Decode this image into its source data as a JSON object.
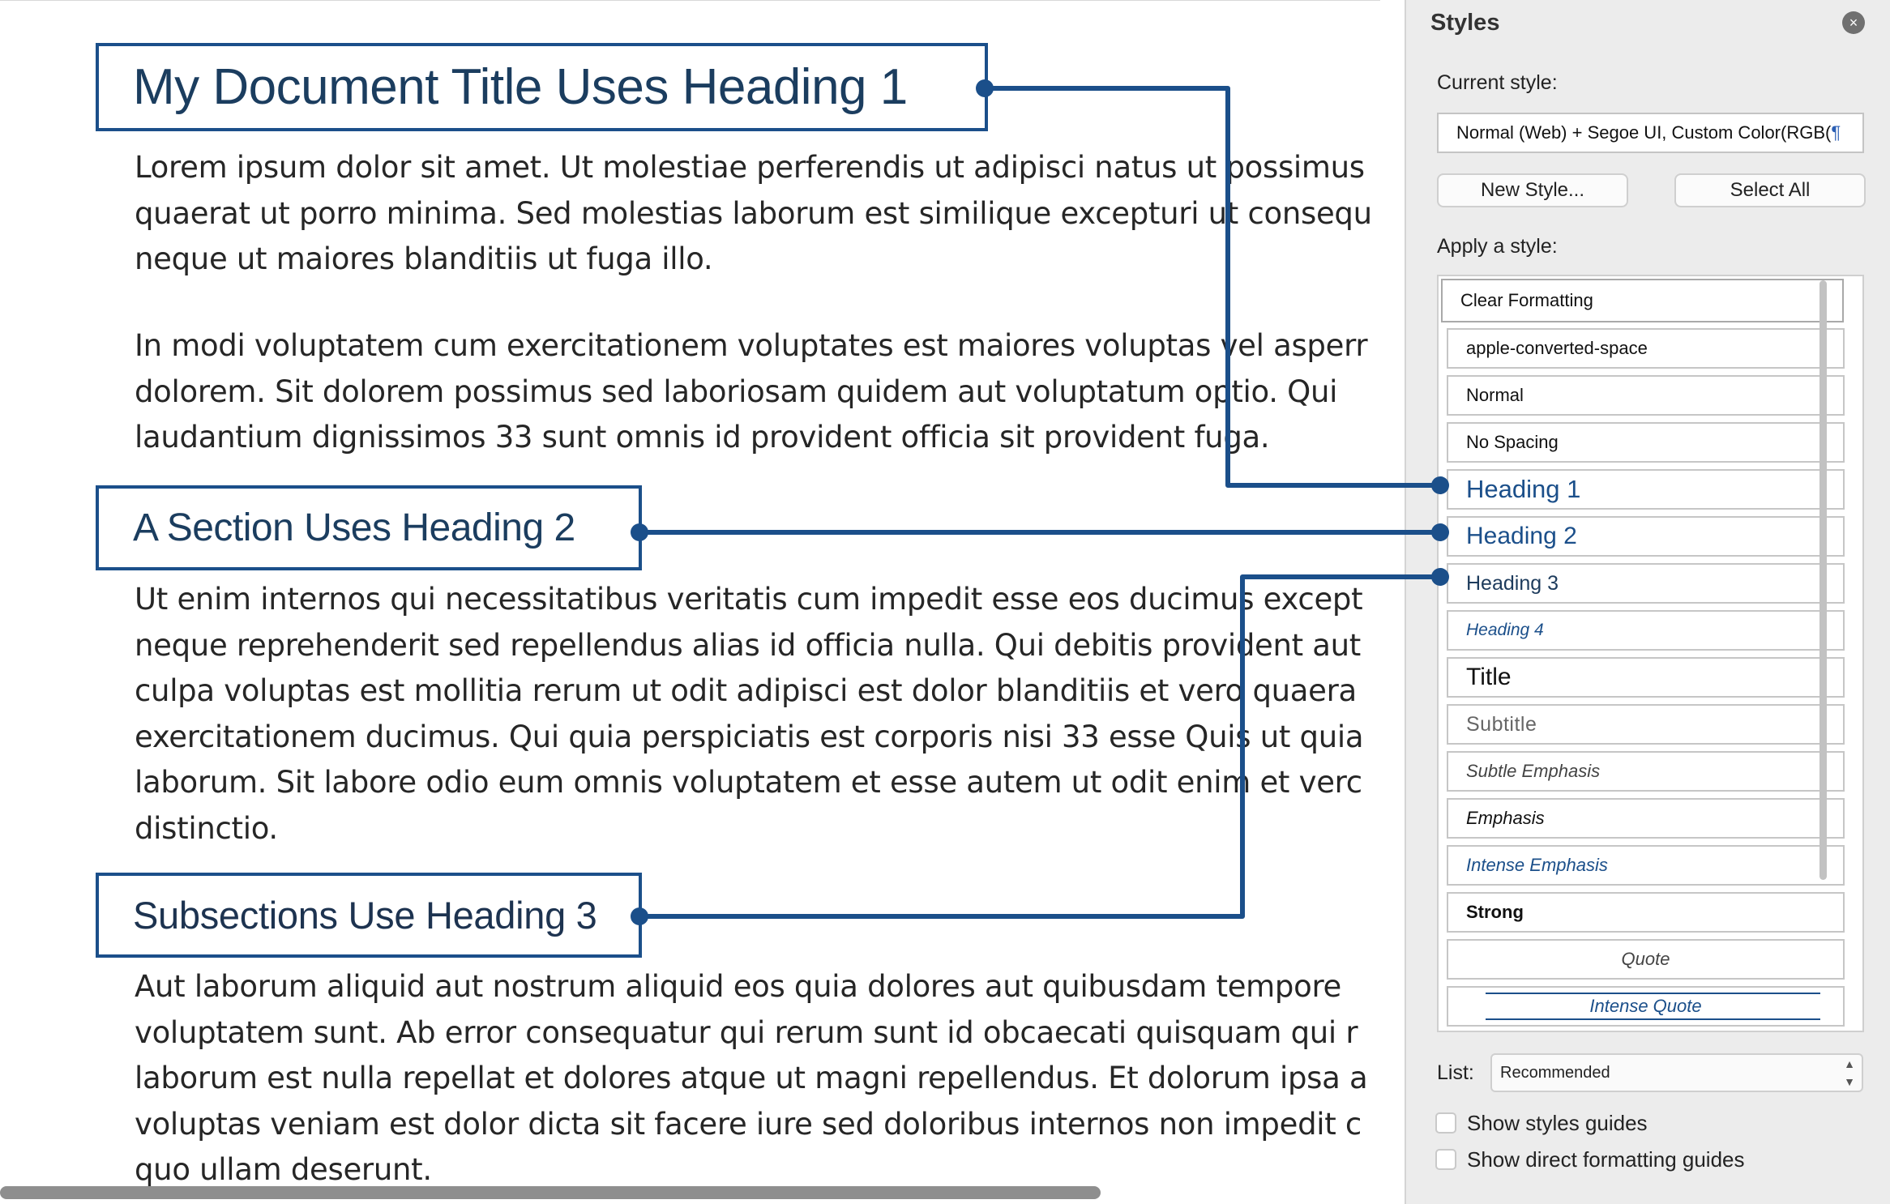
{
  "document": {
    "heading1": "My Document Title Uses Heading 1",
    "para1": [
      "Lorem ipsum dolor sit amet. Ut molestiae perferendis ut adipisci natus ut possimus",
      "quaerat ut porro minima. Sed molestias laborum est similique excepturi ut consequ",
      "neque ut maiores blanditiis ut fuga illo."
    ],
    "para2": [
      "In modi voluptatem cum exercitationem voluptates est maiores voluptas vel asperr",
      "dolorem. Sit dolorem possimus sed laboriosam quidem aut voluptatum optio. Qui",
      "laudantium dignissimos 33 sunt omnis id provident officia sit provident fuga."
    ],
    "heading2": "A Section Uses Heading 2",
    "para3": [
      "Ut enim internos qui necessitatibus veritatis cum impedit esse eos ducimus except",
      "neque reprehenderit sed repellendus alias id officia nulla. Qui debitis provident aut",
      "culpa voluptas est mollitia rerum ut odit adipisci est dolor blanditiis et vero quaera",
      "exercitationem ducimus. Qui quia perspiciatis est corporis nisi 33 esse Quis ut quia",
      "laborum. Sit labore odio eum omnis voluptatem et esse autem ut odit enim et verc",
      "distinctio."
    ],
    "heading3": "Subsections Use Heading 3",
    "para4": [
      "Aut laborum aliquid aut nostrum aliquid eos quia dolores aut quibusdam tempore",
      "voluptatem sunt. Ab error consequatur qui rerum sunt id obcaecati quisquam qui r",
      "laborum est nulla repellat et dolores atque ut magni repellendus. Et dolorum ipsa a",
      "voluptas veniam est dolor dicta sit facere iure sed doloribus internos non impedit c",
      "quo ullam deserunt."
    ]
  },
  "styles_pane": {
    "title": "Styles",
    "close_icon": "×",
    "current_style_label": "Current style:",
    "current_style_value": "Normal (Web) + Segoe UI, Custom Color(RGB(",
    "pilcrow": "¶",
    "new_style_button": "New Style...",
    "select_all_button": "Select All",
    "apply_label": "Apply a style:",
    "styles": [
      "Clear Formatting",
      "apple-converted-space",
      "Normal",
      "No Spacing",
      "Heading 1",
      "Heading 2",
      "Heading 3",
      "Heading 4",
      "Title",
      "Subtitle",
      "Subtle Emphasis",
      "Emphasis",
      "Intense Emphasis",
      "Strong",
      "Quote",
      "Intense Quote"
    ],
    "list_label": "List:",
    "list_value": "Recommended",
    "show_styles_guides": "Show styles guides",
    "show_direct_formatting_guides": "Show direct formatting guides"
  },
  "colors": {
    "accent": "#1b4f8a",
    "pane_background": "#ececec"
  }
}
